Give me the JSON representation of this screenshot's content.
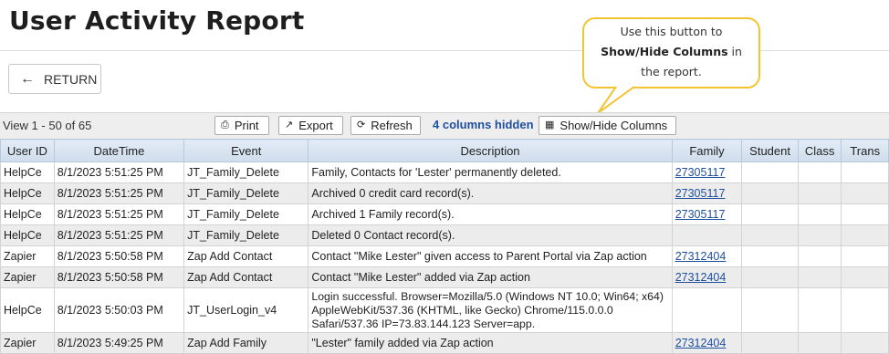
{
  "page": {
    "title": "User Activity Report"
  },
  "return_button": {
    "label": "RETURN"
  },
  "callout": {
    "line1": "Use this button to",
    "bold": "Show/Hide Columns",
    "line2_suffix": " in",
    "line3": "the report."
  },
  "toolbar": {
    "view_count": "View 1 - 50 of 65",
    "print_label": "Print",
    "export_label": "Export",
    "refresh_label": "Refresh",
    "hidden_columns": "4 columns hidden",
    "show_hide_label": "Show/Hide Columns"
  },
  "table": {
    "headers": [
      "User ID",
      "DateTime",
      "Event",
      "Description",
      "Family",
      "Student",
      "Class",
      "Trans"
    ],
    "rows": [
      {
        "user": "HelpCe",
        "datetime": "8/1/2023 5:51:25 PM",
        "event": "JT_Family_Delete",
        "description": "Family, Contacts for 'Lester' permanently deleted.",
        "family": "27305117",
        "student": "",
        "class": "",
        "trans": ""
      },
      {
        "user": "HelpCe",
        "datetime": "8/1/2023 5:51:25 PM",
        "event": "JT_Family_Delete",
        "description": "Archived 0 credit card record(s).",
        "family": "27305117",
        "student": "",
        "class": "",
        "trans": ""
      },
      {
        "user": "HelpCe",
        "datetime": "8/1/2023 5:51:25 PM",
        "event": "JT_Family_Delete",
        "description": "Archived 1 Family record(s).",
        "family": "27305117",
        "student": "",
        "class": "",
        "trans": ""
      },
      {
        "user": "HelpCe",
        "datetime": "8/1/2023 5:51:25 PM",
        "event": "JT_Family_Delete",
        "description": "Deleted 0 Contact record(s).",
        "family": "",
        "student": "",
        "class": "",
        "trans": ""
      },
      {
        "user": "Zapier",
        "datetime": "8/1/2023 5:50:58 PM",
        "event": "Zap Add Contact",
        "description": "Contact \"Mike Lester\" given access to Parent Portal via Zap action",
        "family": "27312404",
        "student": "",
        "class": "",
        "trans": ""
      },
      {
        "user": "Zapier",
        "datetime": "8/1/2023 5:50:58 PM",
        "event": "Zap Add Contact",
        "description": "Contact \"Mike Lester\" added via Zap action",
        "family": "27312404",
        "student": "",
        "class": "",
        "trans": ""
      },
      {
        "user": "HelpCe",
        "datetime": "8/1/2023 5:50:03 PM",
        "event": "JT_UserLogin_v4",
        "description": "Login successful. Browser=Mozilla/5.0 (Windows NT 10.0; Win64; x64) AppleWebKit/537.36 (KHTML, like Gecko) Chrome/115.0.0.0 Safari/537.36 IP=73.83.144.123 Server=app.",
        "family": "",
        "student": "",
        "class": "",
        "trans": ""
      },
      {
        "user": "Zapier",
        "datetime": "8/1/2023 5:49:25 PM",
        "event": "Zap Add Family",
        "description": "\"Lester\" family added via Zap action",
        "family": "27312404",
        "student": "",
        "class": "",
        "trans": ""
      }
    ]
  },
  "icons": {
    "return": "arrow-left-icon",
    "print": "printer-icon",
    "export": "export-icon",
    "refresh": "refresh-icon",
    "show_hide": "columns-icon"
  },
  "colors": {
    "callout_border": "#f4c430",
    "link": "#1f4fa0",
    "header_bg": "#d9e4f1"
  }
}
